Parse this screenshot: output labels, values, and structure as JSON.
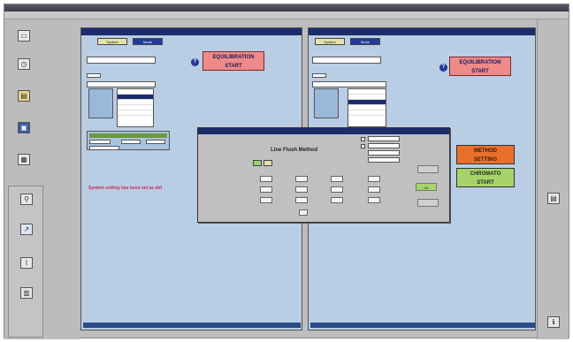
{
  "left_panel": {
    "tab_system": "System",
    "tab_mode": "Mode"
  },
  "equilibration": {
    "label_line1": "EQUILIBRATION",
    "label_line2": "START"
  },
  "error_message": "System setting has been set as def",
  "dialog": {
    "method_title": "Line Flush Method",
    "button_ok": "Ok"
  },
  "right_panel": {
    "method_setting_line1": "METHOD",
    "method_setting_line2": "SETTING",
    "chromato_line1": "CHROMATO",
    "chromato_line2": "START"
  },
  "colors": {
    "panel_bg": "#b9cde4",
    "title_bar": "#1c2c6c",
    "equilibration_btn": "#ef8a8a",
    "method_setting_btn": "#e8702a",
    "chromato_btn": "#a6d46a",
    "error_text": "#c8305a"
  },
  "icons": {
    "sidebar": [
      "monitor-icon",
      "clock-icon",
      "document-icon",
      "computer-icon",
      "tools-icon"
    ],
    "right": [
      "report-icon",
      "info-icon"
    ]
  }
}
